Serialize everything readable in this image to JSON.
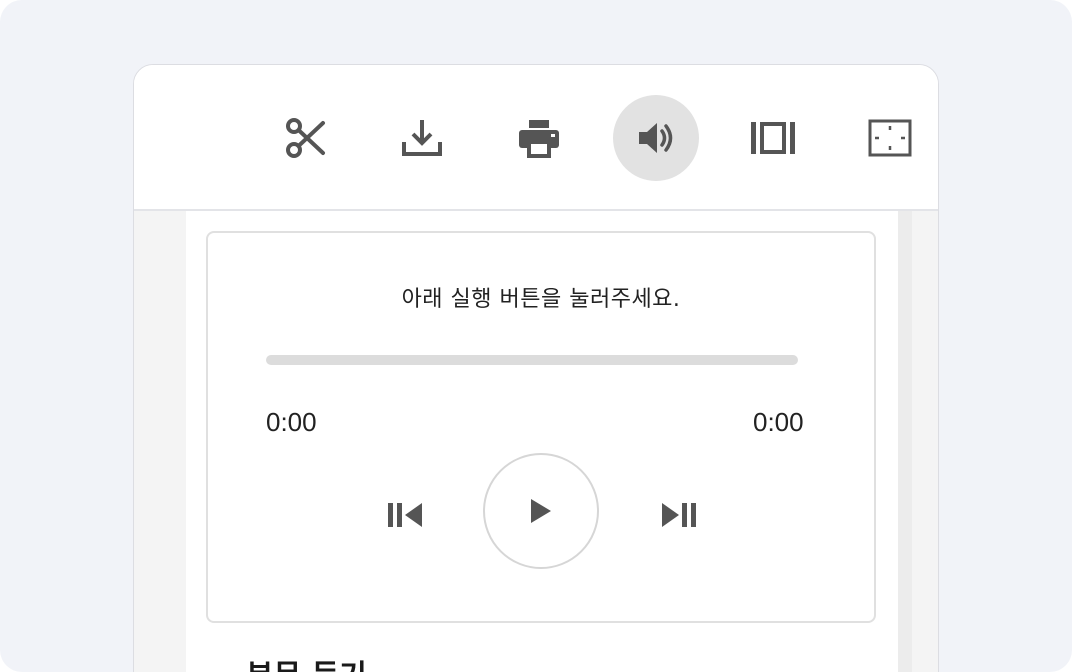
{
  "toolbar": {
    "buttons": [
      {
        "icon": "scissors-icon",
        "active": false
      },
      {
        "icon": "download-icon",
        "active": false
      },
      {
        "icon": "print-icon",
        "active": false
      },
      {
        "icon": "speaker-icon",
        "active": true
      },
      {
        "icon": "page-width-icon",
        "active": false
      },
      {
        "icon": "fit-screen-icon",
        "active": false
      }
    ]
  },
  "player": {
    "instruction": "아래 실행 버튼을 눌러주세요.",
    "current_time": "0:00",
    "total_time": "0:00",
    "progress": 0
  },
  "section": {
    "title": "본문 듣기"
  },
  "colors": {
    "backdrop": "#f1f3f8",
    "icon": "#555555",
    "active_button": "#e2e2e2"
  }
}
